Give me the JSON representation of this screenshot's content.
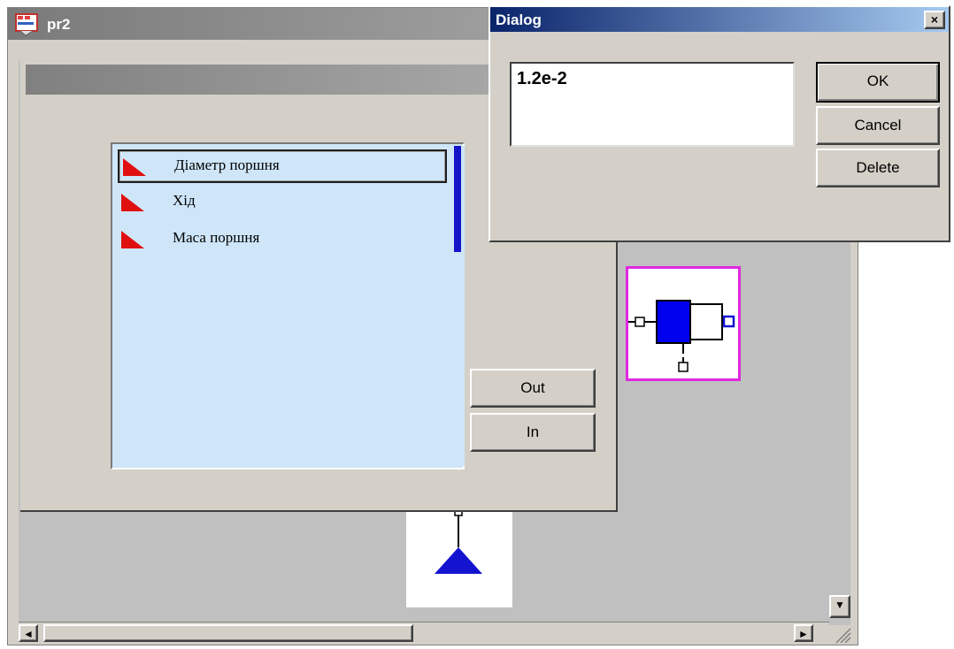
{
  "main_window": {
    "title": "pr2",
    "icon": "app-icon"
  },
  "parameter_list": {
    "items": [
      {
        "label": "Діаметр поршня",
        "selected": true,
        "icon": "red-flag-icon"
      },
      {
        "label": "Хід",
        "selected": false,
        "icon": "red-flag-icon"
      },
      {
        "label": "Маса поршня",
        "selected": false,
        "icon": "red-flag-icon"
      }
    ]
  },
  "buttons": {
    "out_label": "Out",
    "in_label": "In"
  },
  "dialog": {
    "title": "Dialog",
    "close_label": "×",
    "value": "1.2e-2",
    "ok_label": "OK",
    "cancel_label": "Cancel",
    "delete_label": "Delete"
  },
  "scroll": {
    "left_arrow": "◄",
    "right_arrow": "►",
    "down_arrow": "▼"
  },
  "colors": {
    "cylinder_fill": "#0000ee",
    "cylinder_border": "#e028e0",
    "flag": "#e01010",
    "list_bg": "#cfe6f9"
  }
}
